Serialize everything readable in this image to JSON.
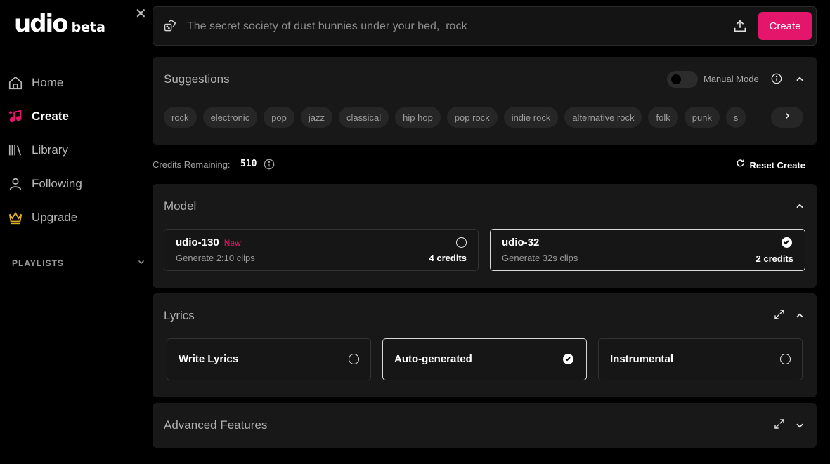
{
  "logo": {
    "name": "udio",
    "badge": "beta"
  },
  "sidebar": {
    "items": [
      {
        "label": "Home",
        "icon": "home-icon",
        "active": false
      },
      {
        "label": "Create",
        "icon": "music-note-icon",
        "active": true
      },
      {
        "label": "Library",
        "icon": "library-icon",
        "active": false
      },
      {
        "label": "Following",
        "icon": "user-icon",
        "active": false
      },
      {
        "label": "Upgrade",
        "icon": "crown-icon",
        "active": false
      }
    ],
    "playlists_label": "PLAYLISTS"
  },
  "prompt": {
    "placeholder": "The secret society of dust bunnies under your bed,  rock",
    "create_label": "Create"
  },
  "suggestions": {
    "title": "Suggestions",
    "manual_mode_label": "Manual Mode",
    "manual_mode_on": false,
    "tags": [
      "rock",
      "electronic",
      "pop",
      "jazz",
      "classical",
      "hip hop",
      "pop rock",
      "indie rock",
      "alternative rock",
      "folk",
      "punk",
      "s"
    ]
  },
  "credits": {
    "label": "Credits Remaining:",
    "value": "510",
    "reset_label": "Reset Create"
  },
  "model": {
    "title": "Model",
    "options": [
      {
        "name": "udio-130",
        "badge": "New!",
        "subtitle": "Generate 2:10 clips",
        "credits": "4 credits",
        "selected": false
      },
      {
        "name": "udio-32",
        "badge": "",
        "subtitle": "Generate 32s clips",
        "credits": "2 credits",
        "selected": true
      }
    ]
  },
  "lyrics": {
    "title": "Lyrics",
    "options": [
      {
        "label": "Write Lyrics",
        "selected": false
      },
      {
        "label": "Auto-generated",
        "selected": true
      },
      {
        "label": "Instrumental",
        "selected": false
      }
    ]
  },
  "advanced": {
    "title": "Advanced Features"
  },
  "colors": {
    "accent": "#e3166b",
    "panel": "#181818",
    "background": "#000000"
  }
}
